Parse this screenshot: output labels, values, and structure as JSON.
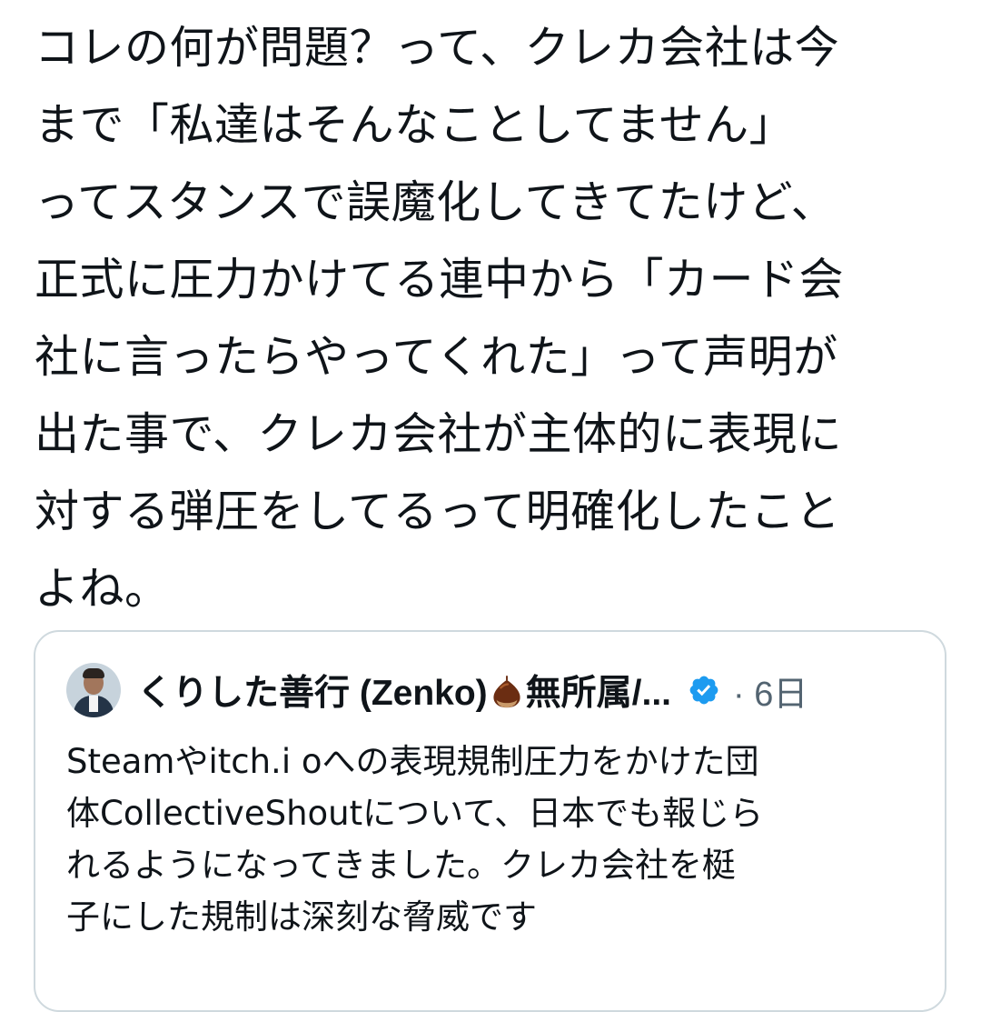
{
  "post": {
    "lines": [
      "コレの何が問題？って、クレカ会社は今",
      "まで「私達はそんなことしてません」",
      "ってスタンスで誤魔化してきてたけど、",
      "正式に圧力かけてる連中から「カード会",
      "社に言ったらやってくれた」って声明が",
      "出た事で、クレカ会社が主体的に表現に",
      "対する弾圧をしてるって明確化したこと",
      "よね。"
    ]
  },
  "quote": {
    "author": {
      "name_part1": "くりした善行 (Zenko)",
      "name_part2": "無所属/...",
      "emoji_icon": "chestnut-icon",
      "verified_icon": "verified-badge-icon"
    },
    "separator": "·",
    "time": "6日",
    "lines": [
      "Steamやitch.i oへの表現規制圧力をかけた団",
      "体CollectiveShoutについて、日本でも報じら",
      "れるようになってきました。クレカ会社を梃",
      "子にした規制は深刻な脅威です"
    ]
  },
  "colors": {
    "text": "#0f1419",
    "secondary_text": "#536471",
    "card_border": "#cfd9de",
    "verified_blue": "#1d9bf0"
  }
}
